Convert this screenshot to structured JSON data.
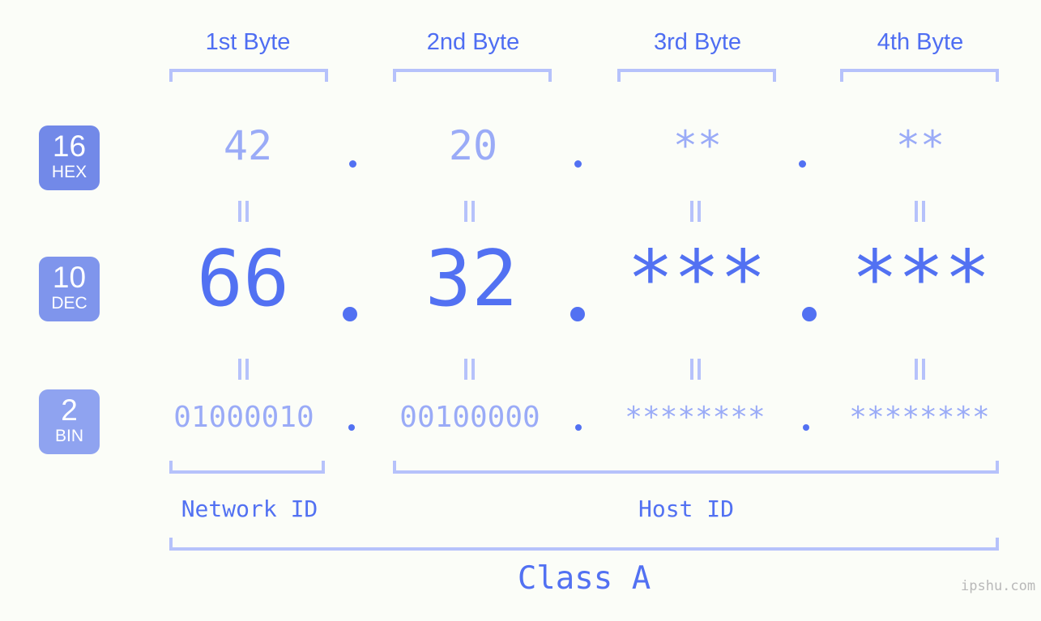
{
  "meta": {
    "watermark": "ipshu.com",
    "background_color": "#fbfdf8",
    "accent_strong": "#5271f2",
    "accent_light": "#9aabf7",
    "bracket_color": "#b6c2fb",
    "badge_color_hex": "#7289e8",
    "badge_color_dec": "#7f95ec",
    "badge_color_bin": "#8fa3f0"
  },
  "columns": [
    {
      "label": "1st Byte"
    },
    {
      "label": "2nd Byte"
    },
    {
      "label": "3rd Byte"
    },
    {
      "label": "4th Byte"
    }
  ],
  "rows": [
    {
      "base_number": "16",
      "base_name": "HEX",
      "values": [
        "42",
        "20",
        "**",
        "**"
      ]
    },
    {
      "base_number": "10",
      "base_name": "DEC",
      "values": [
        "66",
        "32",
        "***",
        "***"
      ]
    },
    {
      "base_number": "2",
      "base_name": "BIN",
      "values": [
        "01000010",
        "00100000",
        "********",
        "********"
      ]
    }
  ],
  "separators": {
    "dot": "."
  },
  "groups": [
    {
      "label": "Network ID"
    },
    {
      "label": "Host ID"
    }
  ],
  "class": {
    "label": "Class A"
  },
  "equivalence": {
    "symbol": "="
  }
}
